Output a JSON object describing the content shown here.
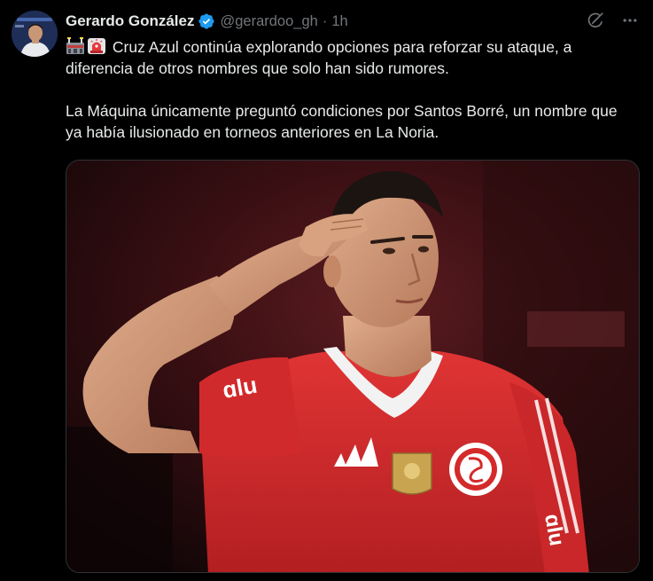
{
  "author": {
    "display_name": "Gerardo González",
    "handle": "@gerardoo_gh",
    "separator": "·",
    "time": "1h",
    "verified": true
  },
  "post": {
    "emojis": [
      "stadium",
      "rotating-light"
    ],
    "paragraph_1": "Cruz Azul continúa explorando opciones para reforzar su ataque, a diferencia de otros nombres que solo han sido rumores.",
    "paragraph_2": "La Máquina únicamente preguntó condiciones por Santos Borré, un nombre que ya había ilusionado en torneos anteriores en La Noria."
  },
  "media": {
    "subject": "player-saluting",
    "jersey_color": "#d42a2a",
    "sponsor_text": "ɑlu"
  },
  "colors": {
    "background": "#000000",
    "text_primary": "#e7e9ea",
    "text_secondary": "#71767b",
    "verified_blue": "#1d9bf0"
  },
  "icons": {
    "verified": "verified-badge-icon",
    "grok": "grok-icon",
    "more": "more-icon"
  }
}
